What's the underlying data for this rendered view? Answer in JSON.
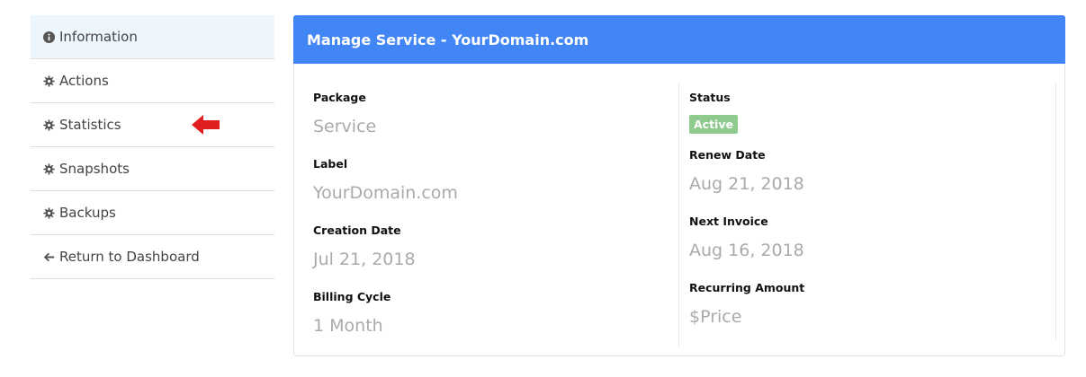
{
  "sidebar": {
    "items": [
      {
        "label": "Information",
        "icon": "info-circle-icon"
      },
      {
        "label": "Actions",
        "icon": "gear-icon"
      },
      {
        "label": "Statistics",
        "icon": "gear-icon"
      },
      {
        "label": "Snapshots",
        "icon": "gear-icon"
      },
      {
        "label": "Backups",
        "icon": "gear-icon"
      },
      {
        "label": "Return to Dashboard",
        "icon": "arrow-left-icon"
      }
    ]
  },
  "panel": {
    "title": "Manage Service - YourDomain.com",
    "left": [
      {
        "label": "Package",
        "value": "Service"
      },
      {
        "label": "Label",
        "value": "YourDomain.com"
      },
      {
        "label": "Creation Date",
        "value": "Jul 21, 2018"
      },
      {
        "label": "Billing Cycle",
        "value": "1 Month"
      }
    ],
    "right": {
      "status_label": "Status",
      "status_badge": "Active",
      "fields": [
        {
          "label": "Renew Date",
          "value": "Aug 21, 2018"
        },
        {
          "label": "Next Invoice",
          "value": "Aug 16, 2018"
        },
        {
          "label": "Recurring Amount",
          "value": "$Price"
        }
      ]
    }
  },
  "colors": {
    "header_bg": "#4285f4",
    "active_item_bg": "#eef6fd",
    "status_badge_bg": "#8fcb8e",
    "annotation_arrow": "#e02020"
  }
}
